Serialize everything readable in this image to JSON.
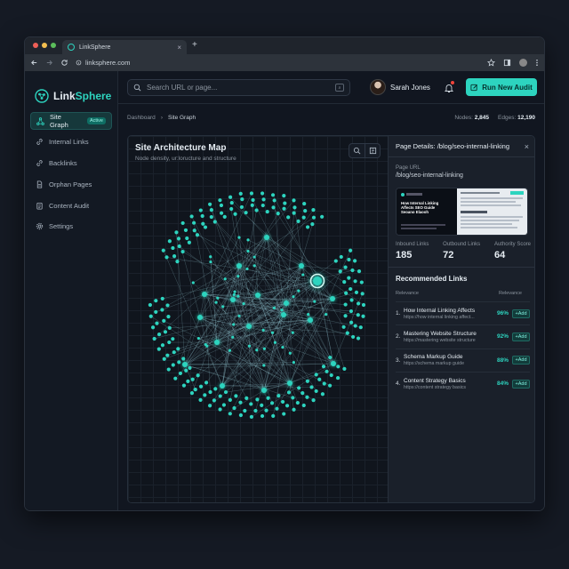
{
  "browser": {
    "tab_title": "LinkSphere",
    "tab_close": "×",
    "new_tab": "+",
    "url": "linksphere.com"
  },
  "app": {
    "logo_prefix": "Link",
    "logo_suffix": "Sphere"
  },
  "sidebar": {
    "items": [
      {
        "label": "Site Graph",
        "icon": "graph-icon",
        "active": true,
        "badge": "Active"
      },
      {
        "label": "Internal Links",
        "icon": "link-icon"
      },
      {
        "label": "Backlinks",
        "icon": "backlink-icon"
      },
      {
        "label": "Orphan Pages",
        "icon": "document-icon"
      },
      {
        "label": "Content Audit",
        "icon": "audit-icon"
      },
      {
        "label": "Settings",
        "icon": "gear-icon"
      }
    ]
  },
  "header": {
    "search_placeholder": "Search URL or page...",
    "user_name": "Sarah Jones",
    "run_audit_label": "Run New Audit"
  },
  "breadcrumb": {
    "root": "Dashboard",
    "separator": "›",
    "current": "Site Graph"
  },
  "stats": {
    "nodes_label": "Nodes:",
    "nodes_value": "2,845",
    "edges_label": "Edges:",
    "edges_value": "12,190"
  },
  "graph": {
    "title": "Site Architecture Map",
    "subtitle": "Node density, ur:loructure and structure",
    "node_color": "#2dd4bf",
    "edge_color": "#a9e4f0"
  },
  "details": {
    "title": "Page Details: /blog/seo-internal-linking",
    "close": "×",
    "url_label": "Page URL",
    "url_value": "/blog/seo-internal-linking",
    "thumb_heading": "How Internal Linking Affects SEO Guide Seoano Elaooh",
    "metrics": [
      {
        "label": "Inbound Links",
        "value": "185"
      },
      {
        "label": "Outbound Links",
        "value": "72"
      },
      {
        "label": "Authority Score",
        "value": "64"
      }
    ],
    "recommended_title": "Recommended Links",
    "col_left": "Relevance",
    "col_right": "Relevance",
    "add_label": "+Add",
    "recommended": [
      {
        "index": "1.",
        "title": "How Internal Linking Affects",
        "url": "https://how internal linking affect...",
        "relevance": "96%"
      },
      {
        "index": "2.",
        "title": "Mastering Website Structure",
        "url": "https://mastering website structure",
        "relevance": "92%"
      },
      {
        "index": "3.",
        "title": "Schema Markup Guide",
        "url": "https://schema markup guide",
        "relevance": "88%"
      },
      {
        "index": "4.",
        "title": "Content Strategy Basics",
        "url": "https://content strategy basics",
        "relevance": "84%"
      }
    ]
  }
}
